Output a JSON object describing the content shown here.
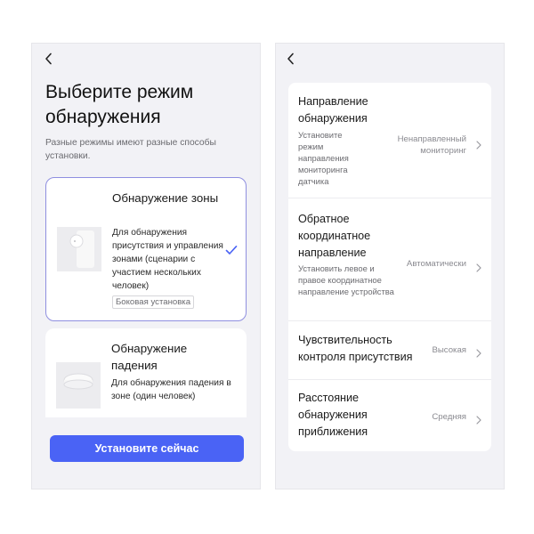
{
  "left": {
    "title": "Выберите режим обнаружения",
    "subtitle": "Разные режимы имеют разные способы установки.",
    "cards": [
      {
        "title": "Обнаружение зоны",
        "desc": "Для обнаружения присутствия и управления зонами (сценарии с участием нескольких человек)",
        "badge": "Боковая установка",
        "selected": true
      },
      {
        "title": "Обнаружение падения",
        "desc": "Для обнаружения падения в зоне (один человек)"
      }
    ],
    "button": "Установите сейчас",
    "accent": "#4a63f5"
  },
  "right": {
    "rows": [
      {
        "title": "Направление обнаружения",
        "desc": "Установите режим направления мониторинга датчика",
        "value": "Ненаправленный мониторинг"
      },
      {
        "title": "Обратное координатное направление",
        "desc": "Установить левое и правое координатное направление устройства",
        "value": "Автоматически"
      },
      {
        "title": "Чувствительность контроля присутствия",
        "desc": "",
        "value": "Высокая"
      },
      {
        "title": "Расстояние обнаружения приближения",
        "desc": "",
        "value": "Средняя"
      }
    ]
  },
  "icons": [
    "back-icon",
    "checkmark-icon",
    "chevron-right-icon"
  ]
}
